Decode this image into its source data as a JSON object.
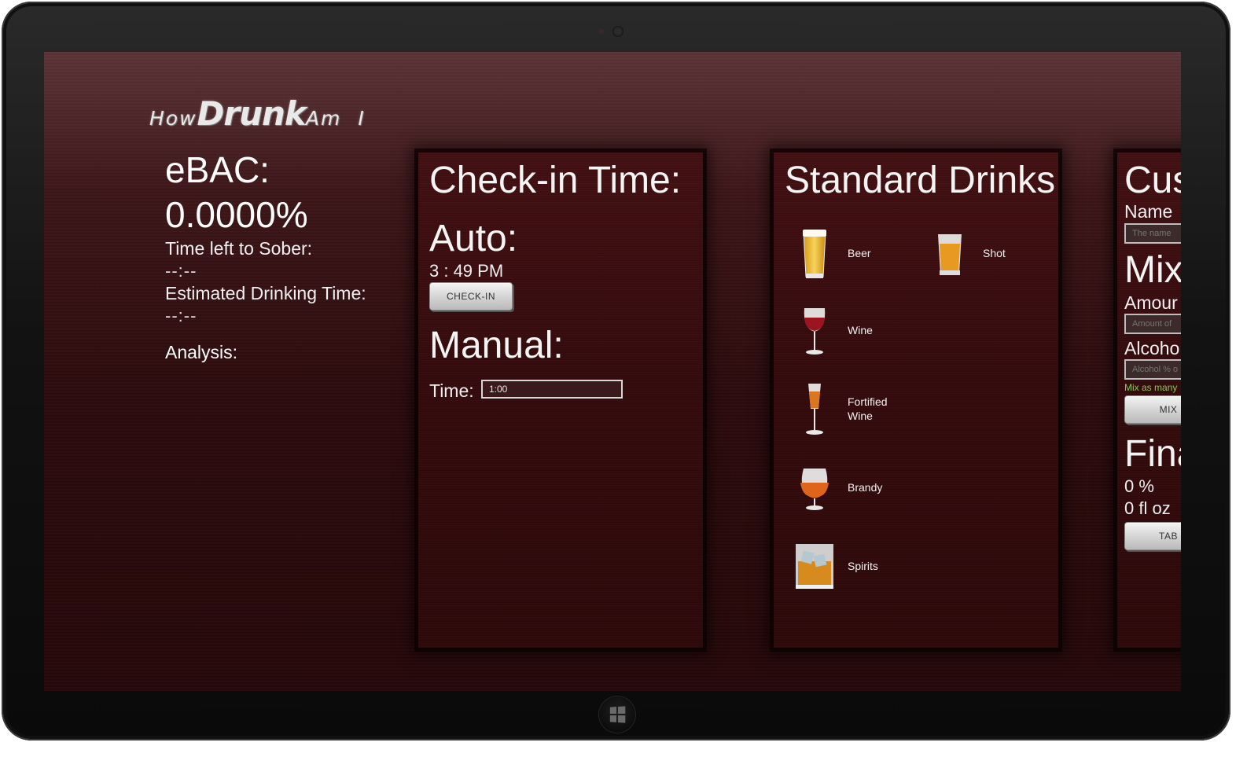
{
  "app": {
    "logo": {
      "part1": "How",
      "part2": "Drunk",
      "part3": "Am",
      "part4": "I"
    }
  },
  "status": {
    "ebac_label": "eBAC:",
    "ebac_value": "0.0000%",
    "sober_label": "Time left to Sober:",
    "sober_value": "--:--",
    "drinking_label": "Estimated Drinking Time:",
    "drinking_value": "--:--",
    "analysis_label": "Analysis:"
  },
  "checkin": {
    "title": "Check-in Time:",
    "auto_label": "Auto:",
    "auto_time": "3 : 49 PM",
    "checkin_button": "CHECK-IN",
    "manual_label": "Manual:",
    "time_label": "Time:",
    "time_value": "1:00"
  },
  "standard": {
    "title": "Standard Drinks",
    "drinks": [
      {
        "label": "Beer",
        "icon": "beer-glass-icon"
      },
      {
        "label": "Shot",
        "icon": "shot-glass-icon"
      },
      {
        "label": "Wine",
        "icon": "wine-glass-icon"
      },
      {
        "label": "Fortified",
        "label2": "Wine",
        "icon": "fortified-wine-glass-icon"
      },
      {
        "label": "Brandy",
        "icon": "brandy-snifter-icon"
      },
      {
        "label": "Spirits",
        "icon": "spirits-glass-icon"
      }
    ]
  },
  "custom": {
    "title": "Cus",
    "name_label": "Name",
    "name_placeholder": "The name",
    "mix_head": "Mix",
    "amount_label": "Amour",
    "amount_placeholder": "Amount of",
    "alcohol_label": "Alcoho",
    "alcohol_placeholder": "Alcohol % o",
    "mix_hint": "Mix as many",
    "mix_button": "MIX",
    "final_head": "Fina",
    "final_percent": "0 %",
    "final_volume": "0 fl oz",
    "tab_button": "TAB"
  },
  "colors": {
    "background": "#2c0b0d",
    "panel": "#340a0c",
    "hint": "#7fcf4a"
  }
}
